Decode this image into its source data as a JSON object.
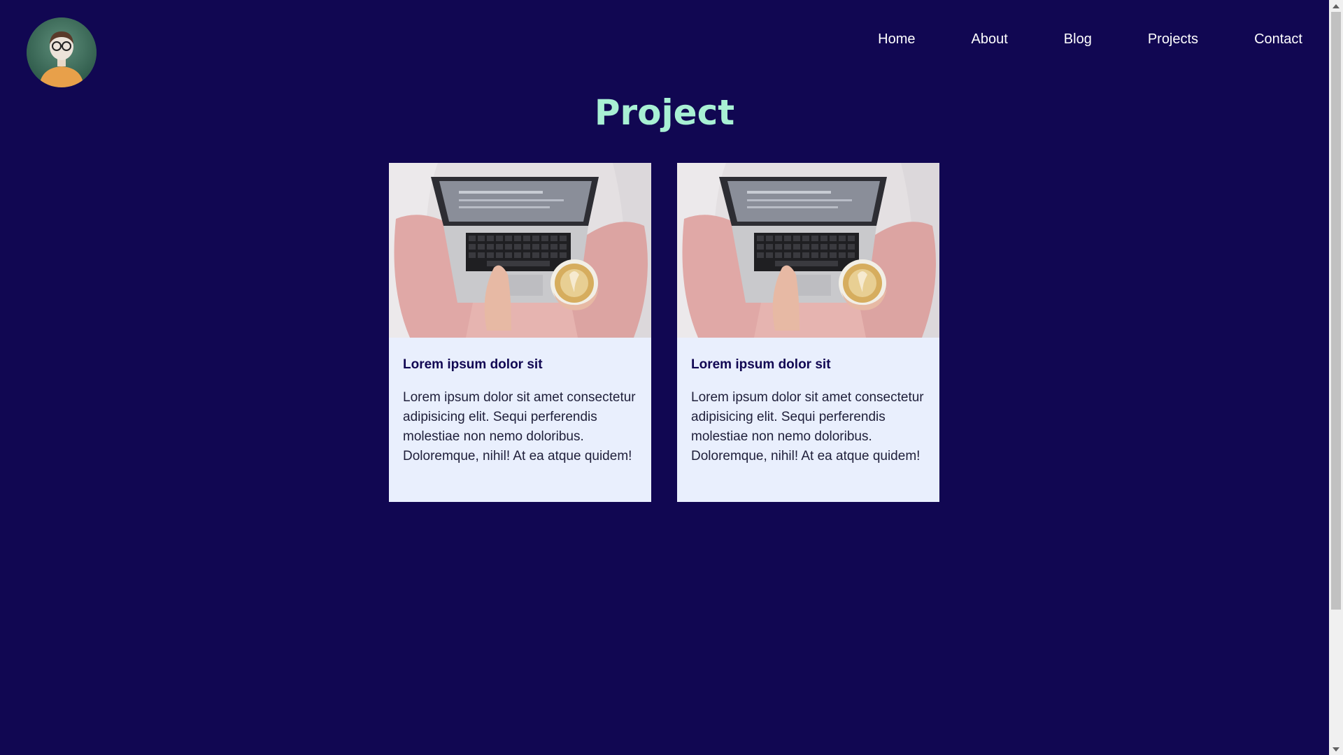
{
  "nav": {
    "items": [
      {
        "label": "Home"
      },
      {
        "label": "About"
      },
      {
        "label": "Blog"
      },
      {
        "label": "Projects"
      },
      {
        "label": "Contact"
      }
    ]
  },
  "page": {
    "title": "Project"
  },
  "cards": [
    {
      "title": "Lorem ipsum dolor sit",
      "text": "Lorem ipsum dolor sit amet consectetur adipisicing elit. Sequi perferendis molestiae non nemo doloribus. Doloremque, nihil! At ea atque quidem!"
    },
    {
      "title": "Lorem ipsum dolor sit",
      "text": "Lorem ipsum dolor sit amet consectetur adipisicing elit. Sequi perferendis molestiae non nemo doloribus. Doloremque, nihil! At ea atque quidem!"
    }
  ],
  "colors": {
    "background": "#110752",
    "title": "#a8f0d4",
    "card_background": "#e9effd",
    "card_title": "#110752"
  }
}
